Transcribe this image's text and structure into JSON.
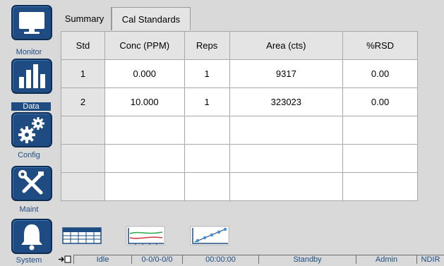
{
  "sidebar": {
    "items": [
      {
        "label": "Monitor",
        "icon": "monitor-icon"
      },
      {
        "label": "Data",
        "icon": "bar-chart-icon",
        "active": true
      },
      {
        "label": "Config",
        "icon": "gears-icon"
      },
      {
        "label": "Maint",
        "icon": "tools-icon"
      },
      {
        "label": "System",
        "icon": "bell-icon"
      }
    ]
  },
  "tabs": [
    {
      "label": "Summary",
      "selected": false
    },
    {
      "label": "Cal Standards",
      "selected": true
    }
  ],
  "table": {
    "columns": [
      "Std",
      "Conc (PPM)",
      "Reps",
      "Area (cts)",
      "%RSD"
    ],
    "rows": [
      [
        "1",
        "0.000",
        "1",
        "9317",
        "0.00"
      ],
      [
        "2",
        "10.000",
        "1",
        "323023",
        "0.00"
      ]
    ],
    "blank_rows": 3
  },
  "view_buttons": [
    {
      "name": "table-view",
      "icon": "table-grid-icon"
    },
    {
      "name": "trend-view",
      "icon": "trend-lines-icon"
    },
    {
      "name": "calibration-view",
      "icon": "calibration-curve-icon"
    }
  ],
  "status_bar": {
    "state": "Idle",
    "sequence": "0-0/0-0/0",
    "time": "00:00:00",
    "mode": "Standby",
    "user": "Admin",
    "detector": "NDIR"
  },
  "colors": {
    "accent": "#1e4c82",
    "background": "#d9d9d9",
    "cell_background": "#ffffff"
  }
}
